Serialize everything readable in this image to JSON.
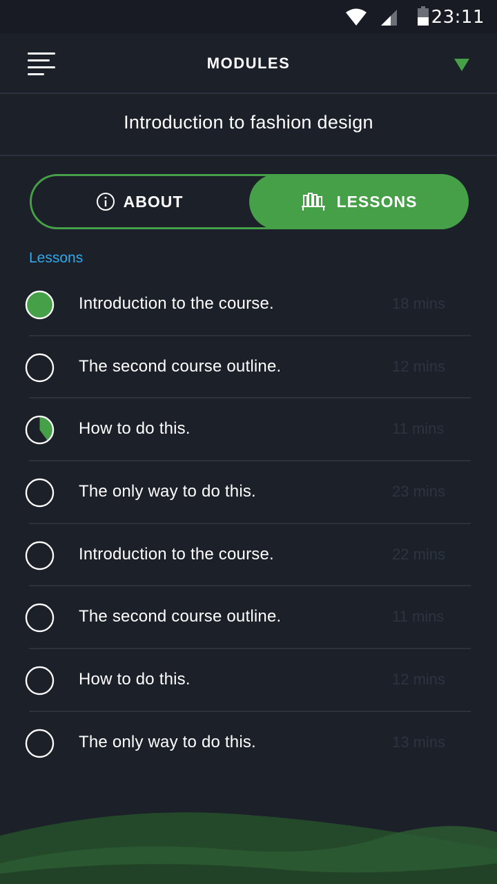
{
  "status_bar": {
    "time": "23:11",
    "icons": [
      "wifi-icon",
      "cell-signal-icon",
      "battery-icon"
    ]
  },
  "app_bar": {
    "title": "MODULES",
    "menu_icon": "menu-icon",
    "dropdown_icon": "triangle-down-icon"
  },
  "course": {
    "title": "Introduction to fashion design"
  },
  "tabs": [
    {
      "label": "ABOUT",
      "icon": "info-icon",
      "selected": false
    },
    {
      "label": "LESSONS",
      "icon": "library-icon",
      "selected": true
    }
  ],
  "section_label": "Lessons",
  "lessons": [
    {
      "title": "Introduction to the course.",
      "duration": "18 mins",
      "progress": 1.0
    },
    {
      "title": "The second course outline.",
      "duration": "12 mins",
      "progress": 0
    },
    {
      "title": "How to do this.",
      "duration": "11 mins",
      "progress": 0.4
    },
    {
      "title": "The only way to do this.",
      "duration": "23 mins",
      "progress": 0
    },
    {
      "title": "Introduction to the course.",
      "duration": "22 mins",
      "progress": 0
    },
    {
      "title": "The second course outline.",
      "duration": "11 mins",
      "progress": 0
    },
    {
      "title": "How to do this.",
      "duration": "12 mins",
      "progress": 0
    },
    {
      "title": "The only way to do this.",
      "duration": "13 mins",
      "progress": 0
    }
  ],
  "colors": {
    "background": "#1c2029",
    "accent": "#45a047",
    "section_label": "#2eaaee",
    "duration_text": "#2d3440"
  }
}
